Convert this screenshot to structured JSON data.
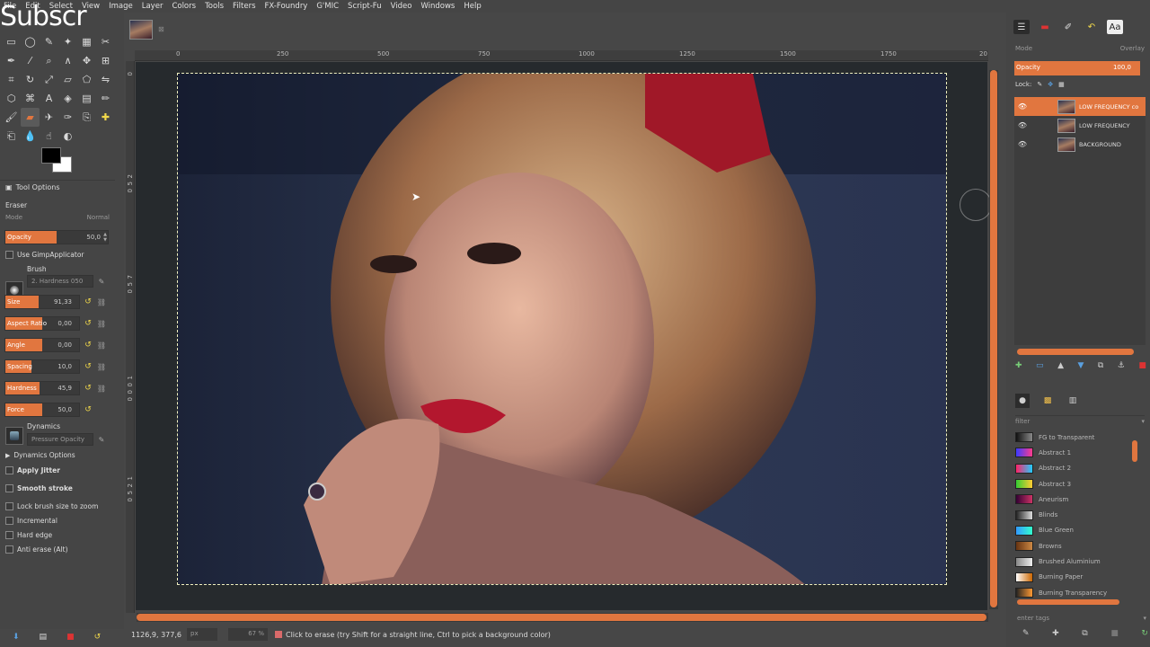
{
  "watermark": "Subscr",
  "menu": [
    "File",
    "Edit",
    "Select",
    "View",
    "Image",
    "Layer",
    "Colors",
    "Tools",
    "Filters",
    "FX-Foundry",
    "G'MIC",
    "Script-Fu",
    "Video",
    "Windows",
    "Help"
  ],
  "tool_options": {
    "header": "Tool Options",
    "tool_name": "Eraser",
    "mode_label": "Mode",
    "mode_value": "Normal",
    "opacity": {
      "label": "Opacity",
      "value": "50,0",
      "fraction": 0.5
    },
    "use_applicator": "Use GimpApplicator",
    "brush_label": "Brush",
    "brush_name": "2. Hardness 050",
    "size": {
      "label": "Size",
      "value": "91,33",
      "fraction": 0.45
    },
    "aspect": {
      "label": "Aspect Ratio",
      "value": "0,00",
      "fraction": 0.5
    },
    "angle": {
      "label": "Angle",
      "value": "0,00",
      "fraction": 0.5
    },
    "spacing": {
      "label": "Spacing",
      "value": "10,0",
      "fraction": 0.35
    },
    "hardness": {
      "label": "Hardness",
      "value": "45,9",
      "fraction": 0.46
    },
    "force": {
      "label": "Force",
      "value": "50,0",
      "fraction": 0.5
    },
    "dynamics_label": "Dynamics",
    "dynamics_value": "Pressure Opacity",
    "dynamics_options": "Dynamics Options",
    "apply_jitter": "Apply Jitter",
    "smooth_stroke": "Smooth stroke",
    "lock_brush": "Lock brush size to zoom",
    "incremental": "Incremental",
    "hard_edge": "Hard edge",
    "anti_erase": "Anti erase  (Alt)"
  },
  "ruler": {
    "h": [
      "0",
      "250",
      "500",
      "750",
      "1000",
      "1250",
      "1500",
      "1750",
      "20"
    ],
    "v": [
      "0",
      "2",
      "5",
      "0",
      "7",
      "5",
      "0",
      "1",
      "0",
      "0",
      "0",
      "1",
      "2",
      "5",
      "0"
    ]
  },
  "status": {
    "coords": "1126,9, 377,6",
    "unit": "px",
    "zoom": "67 %",
    "message": "Click to erase (try Shift for a straight line, Ctrl to pick a background color)"
  },
  "layers_panel": {
    "mode_label": "Mode",
    "mode_value": "Overlay",
    "opacity_label": "Opacity",
    "opacity_value": "100,0",
    "lock_label": "Lock:",
    "layers": [
      {
        "name": "LOW FREQUENCY co",
        "selected": true
      },
      {
        "name": "LOW FREQUENCY",
        "selected": false
      },
      {
        "name": "BACKGROUND",
        "selected": false
      }
    ]
  },
  "gradients": {
    "filter_label": "filter",
    "tags_placeholder": "enter tags",
    "items": [
      {
        "name": "FG to Transparent",
        "c1": "#111",
        "c2": "#888"
      },
      {
        "name": "Abstract 1",
        "c1": "#3b3bff",
        "c2": "#ff3b8c"
      },
      {
        "name": "Abstract 2",
        "c1": "#ff2266",
        "c2": "#22ccff"
      },
      {
        "name": "Abstract 3",
        "c1": "#33cc33",
        "c2": "#ffcc33"
      },
      {
        "name": "Aneurism",
        "c1": "#330033",
        "c2": "#cc3366"
      },
      {
        "name": "Blinds",
        "c1": "#222",
        "c2": "#ddd"
      },
      {
        "name": "Blue Green",
        "c1": "#3399ff",
        "c2": "#33ffcc"
      },
      {
        "name": "Browns",
        "c1": "#663311",
        "c2": "#cc8844"
      },
      {
        "name": "Brushed Aluminium",
        "c1": "#888",
        "c2": "#eee"
      },
      {
        "name": "Burning Paper",
        "c1": "#fff",
        "c2": "#cc6600"
      },
      {
        "name": "Burning Transparency",
        "c1": "#222",
        "c2": "#ff9933"
      }
    ]
  },
  "colors": {
    "accent": "#e1763f",
    "panel": "#454545",
    "canvas_bg": "#262a2d"
  }
}
